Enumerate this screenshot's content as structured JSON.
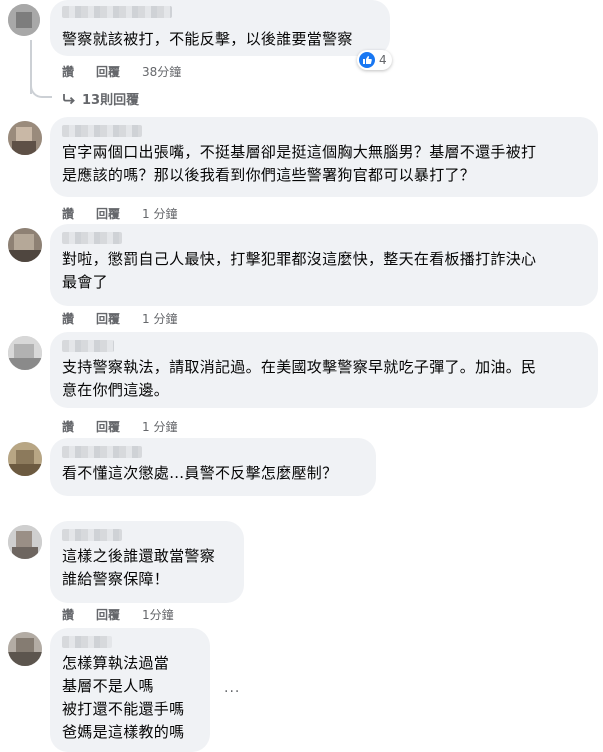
{
  "comments": [
    {
      "text": "警察就該被打，不能反擊，以後誰要當警察",
      "actions": {
        "like": "讚",
        "reply": "回覆",
        "time": "38分鐘"
      },
      "reaction": {
        "icon": "like-icon",
        "count": "4",
        "color": "#1877f2"
      }
    },
    {
      "text": "官字兩個口出張嘴，不挺基層卻是挺這個胸大無腦男？基層不還手被打\n是應該的嗎？那以後我看到你們這些警署狗官都可以暴打了？",
      "actions": {
        "like": "讚",
        "reply": "回覆",
        "time": "1 分鐘"
      }
    },
    {
      "text": "對啦，懲罰自己人最快，打擊犯罪都沒這麼快，整天在看板播打詐決心\n最會了",
      "actions": {
        "like": "讚",
        "reply": "回覆",
        "time": "1 分鐘"
      }
    },
    {
      "text": "支持警察執法，請取消記過。在美國攻擊警察早就吃子彈了。加油。民\n意在你們這邊。",
      "actions": {
        "like": "讚",
        "reply": "回覆",
        "time": "1 分鐘"
      }
    },
    {
      "text": "看不懂這次懲處…員警不反擊怎麼壓制？"
    },
    {
      "text": "這樣之後誰還敢當警察\n誰給警察保障！",
      "actions": {
        "like": "讚",
        "reply": "回覆",
        "time": "1分鐘"
      }
    },
    {
      "text": "怎樣算執法過當\n基層不是人嗎\n被打還不能還手嗎\n爸媽是這樣教的嗎"
    }
  ],
  "view_replies": {
    "label": "13則回覆",
    "icon": "reply-arrow-icon"
  },
  "more_options": {
    "icon": "more-options-icon",
    "label": "···"
  },
  "colors": {
    "bubble": "#f0f2f5",
    "meta_text": "#65676b",
    "like_blue": "#1877f2"
  }
}
